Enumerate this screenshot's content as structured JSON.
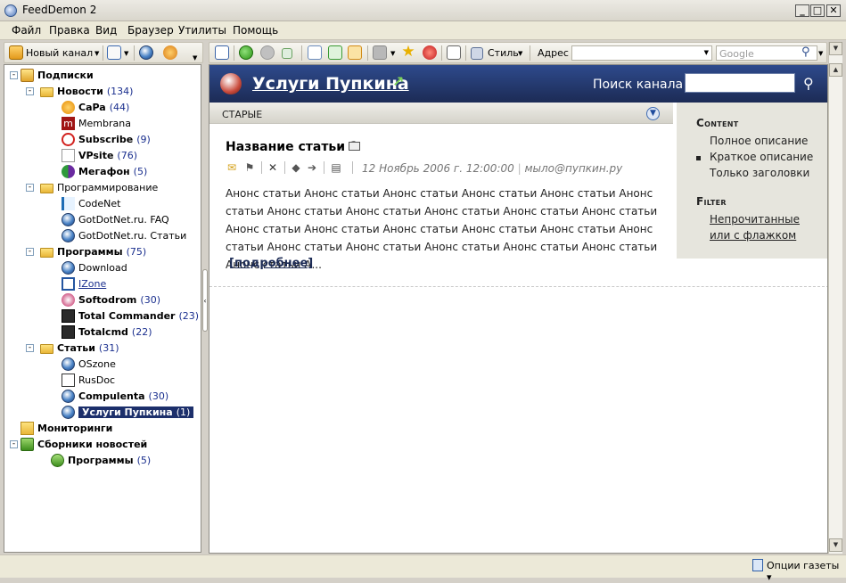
{
  "window": {
    "title": "FeedDemon 2",
    "min": "_",
    "max": "□",
    "close": "✕"
  },
  "menu": [
    "Файл",
    "Правка",
    "Вид",
    "Браузер",
    "Утилиты",
    "Помощь"
  ],
  "left_toolbar": {
    "new_channel": "Новый канал"
  },
  "right_toolbar": {
    "style": "Стиль",
    "address": "Адрес",
    "search_placeholder": "Google"
  },
  "tree": [
    {
      "label": "Подписки",
      "bold": true,
      "level": 0,
      "expand": "-",
      "icon": "subscriptions-icon"
    },
    {
      "label": "Новости",
      "count": "(134)",
      "bold": true,
      "level": 1,
      "expand": "-",
      "icon": "folder-icon"
    },
    {
      "label": "CaPa",
      "count": "(44)",
      "bold": true,
      "level": 2,
      "icon": "capa-icon"
    },
    {
      "label": "Membrana",
      "level": 2,
      "icon": "membrana-icon"
    },
    {
      "label": "Subscribe",
      "count": "(9)",
      "bold": true,
      "level": 2,
      "icon": "subscribe-icon"
    },
    {
      "label": "VPsite",
      "count": "(76)",
      "bold": true,
      "level": 2,
      "icon": "vpsite-icon"
    },
    {
      "label": "Мегафон",
      "count": "(5)",
      "bold": true,
      "level": 2,
      "icon": "megafon-icon"
    },
    {
      "label": "Программирование",
      "level": 1,
      "expand": "-",
      "icon": "folder-icon"
    },
    {
      "label": "CodeNet",
      "level": 2,
      "icon": "codenet-icon"
    },
    {
      "label": "GotDotNet.ru. FAQ",
      "level": 2,
      "icon": "globe-icon"
    },
    {
      "label": "GotDotNet.ru. Статьи",
      "level": 2,
      "icon": "globe-icon"
    },
    {
      "label": "Программы",
      "count": "(75)",
      "bold": true,
      "level": 1,
      "expand": "-",
      "icon": "folder-icon"
    },
    {
      "label": "Download",
      "level": 2,
      "icon": "globe-icon"
    },
    {
      "label": "IZone",
      "level": 2,
      "icon": "izone-icon",
      "link": true
    },
    {
      "label": "Softodrom",
      "count": "(30)",
      "bold": true,
      "level": 2,
      "icon": "softodrom-icon"
    },
    {
      "label": "Total Commander",
      "count": "(23)",
      "bold": true,
      "level": 2,
      "icon": "floppy-icon"
    },
    {
      "label": "Totalcmd",
      "count": "(22)",
      "bold": true,
      "level": 2,
      "icon": "floppy-icon"
    },
    {
      "label": "Статьи",
      "count": "(31)",
      "bold": true,
      "level": 1,
      "expand": "-",
      "icon": "folder-icon"
    },
    {
      "label": "OSzone",
      "level": 2,
      "icon": "globe-icon"
    },
    {
      "label": "RusDoc",
      "level": 2,
      "icon": "rusdoc-icon"
    },
    {
      "label": "Compulenta",
      "count": "(30)",
      "bold": true,
      "level": 2,
      "icon": "globe-icon"
    },
    {
      "label": "Услуги Пупкина",
      "count": "(1)",
      "bold": true,
      "level": 2,
      "icon": "globe-icon",
      "selected": true
    },
    {
      "label": "Мониторинги",
      "bold": true,
      "level": 0,
      "icon": "monitor-folder-icon"
    },
    {
      "label": "Сборники новостей",
      "bold": true,
      "level": 0,
      "expand": "-",
      "icon": "newsbin-icon"
    },
    {
      "label": "Программы",
      "count": "(5)",
      "bold": true,
      "level": 1,
      "icon": "newsbin-item-icon"
    }
  ],
  "feed": {
    "title": "Услуги Пупкина",
    "search_label": "Поиск канала",
    "old_label": "СТАРЫЕ",
    "article": {
      "title": "Название статьи 1",
      "date": "12 Ноябрь 2006 г. 12:00:00",
      "author": "мыло@пупкин.ру",
      "summary": "Анонс статьи Анонс статьи Анонс статьи Анонс статьи Анонс статьи Анонс статьи Анонс статьи Анонс статьи Анонс статьи Анонс статьи Анонс статьи Анонс статьи Анонс статьи Анонс статьи Анонс статьи Анонс статьи Анонс статьи Анонс статьи Анонс статьи Анонс статьи Анонс статьи Анонс статьи Анонс статьи А...",
      "more": "[подробнее]"
    },
    "side": {
      "content_header": "Content",
      "content_options": [
        "Полное описание",
        "Краткое описание",
        "Только заголовки"
      ],
      "selected_option": 1,
      "filter_header": "Filter",
      "filter_link": "Непрочитанные или с флажком"
    }
  },
  "status": {
    "newspaper_options": "Опции газеты"
  }
}
